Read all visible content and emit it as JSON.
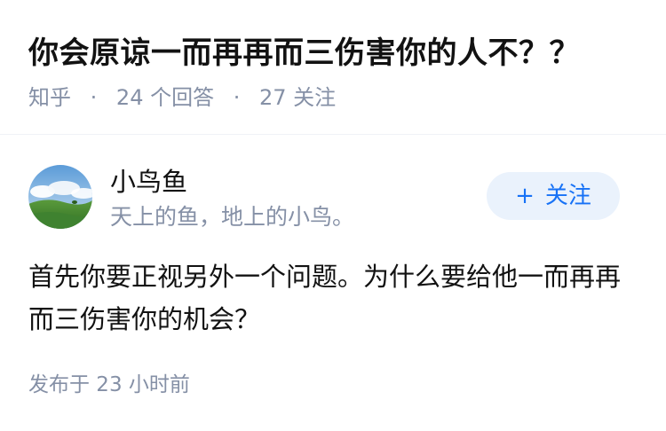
{
  "question": {
    "title": "你会原谅一而再再而三伤害你的人不？？",
    "source": "知乎",
    "answer_count": "24 个回答",
    "follow_count": "27 关注",
    "separator": "·"
  },
  "answer": {
    "author": {
      "name": "小鸟鱼",
      "bio": "天上的鱼，地上的小鸟。",
      "avatar_icon": "landscape-avatar-icon"
    },
    "follow_button": {
      "icon": "+",
      "label": "关注"
    },
    "content": "首先你要正视另外一个问题。为什么要给他一而再再而三伤害你的机会？",
    "time": "发布于 23 小时前"
  },
  "colors": {
    "text": "#121212",
    "meta": "#8590a6",
    "accent": "#1772f6",
    "button_bg": "#eaf2fc"
  }
}
